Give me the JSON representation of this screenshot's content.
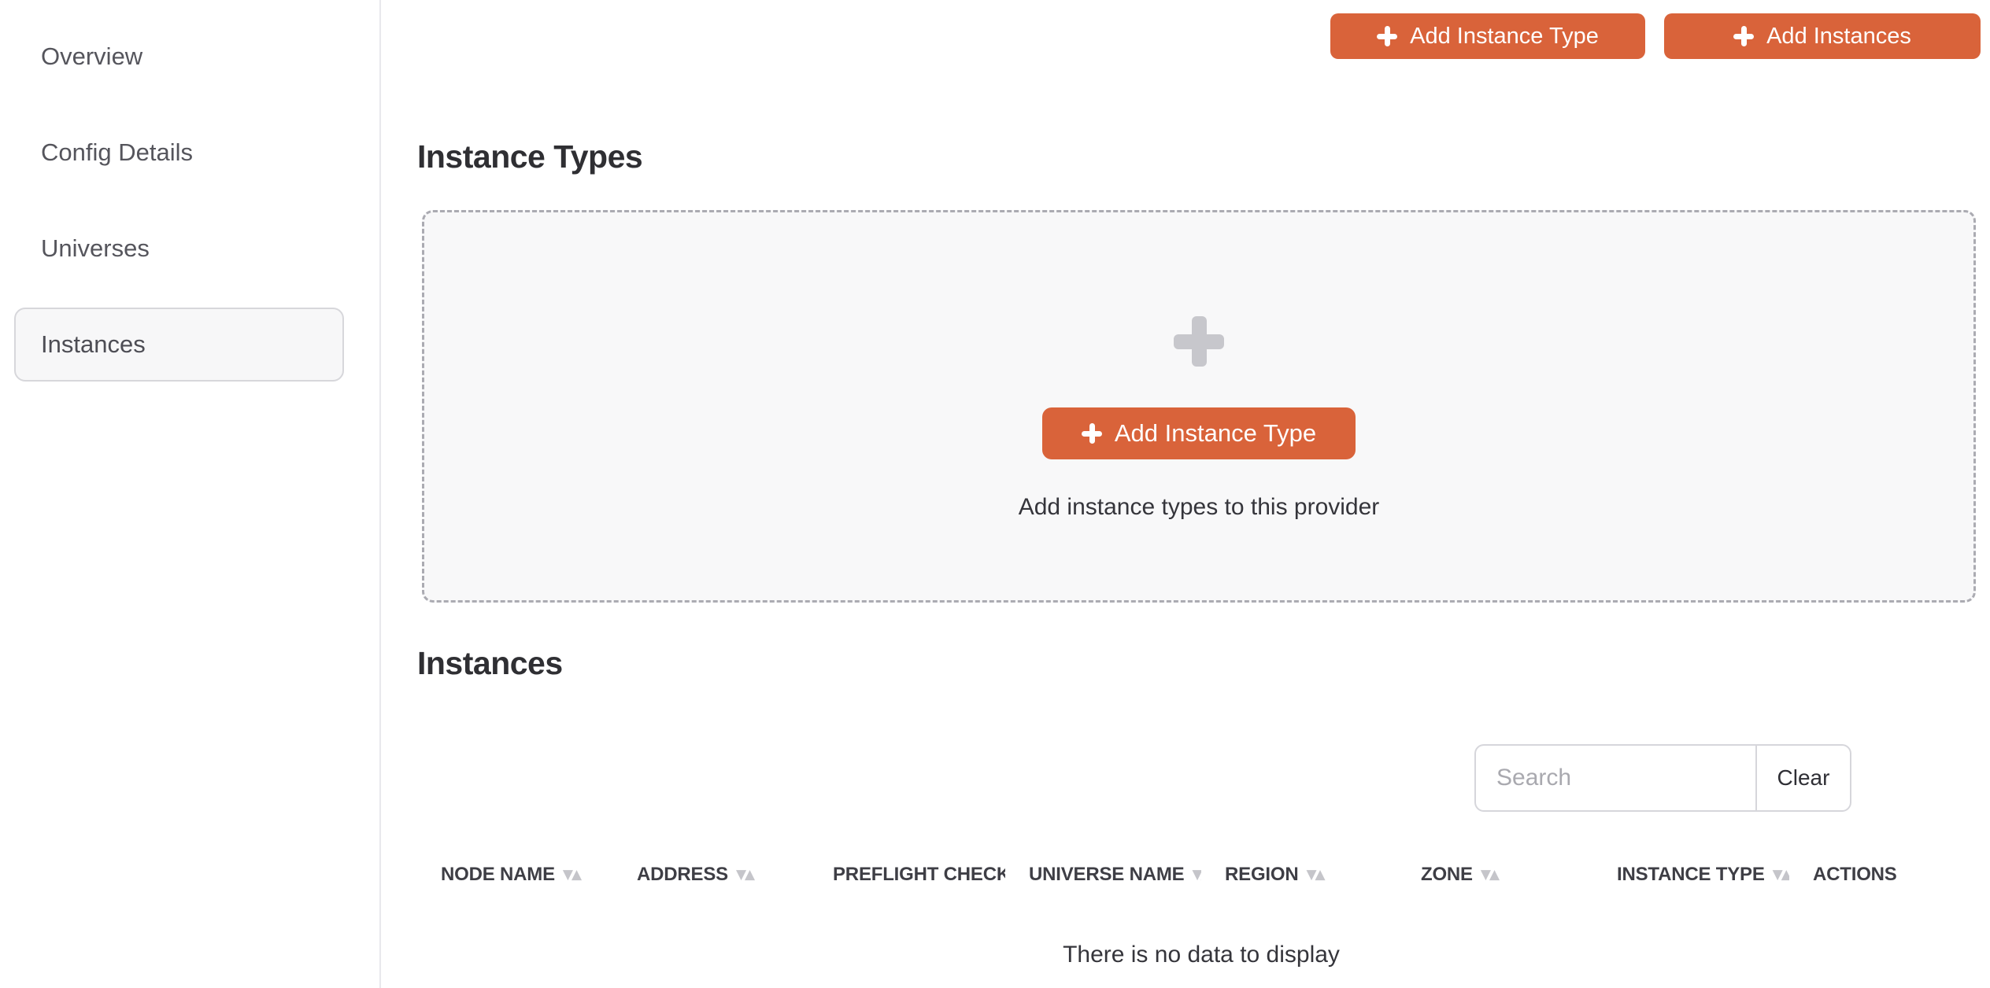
{
  "colors": {
    "accent_orange": "#d9633a",
    "sidebar_selected_bg": "#f7f7f8",
    "dashed_box_bg": "#f8f8f9",
    "dashed_border": "#ababb2",
    "muted_icon_gray": "#c7c7cc"
  },
  "sidebar": {
    "items": [
      {
        "label": "Overview",
        "selected": false
      },
      {
        "label": "Config Details",
        "selected": false
      },
      {
        "label": "Universes",
        "selected": false
      },
      {
        "label": "Instances",
        "selected": true
      }
    ]
  },
  "toolbar": {
    "add_instance_type_label": "Add Instance Type",
    "add_instances_label": "Add Instances"
  },
  "instance_types_section": {
    "title": "Instance Types",
    "empty_state": {
      "button_label": "Add Instance Type",
      "caption": "Add instance types to this provider"
    }
  },
  "instances_section": {
    "title": "Instances",
    "search": {
      "placeholder": "Search",
      "value": "",
      "clear_label": "Clear"
    },
    "table": {
      "columns": [
        {
          "label": "NODE NAME",
          "sortable": true
        },
        {
          "label": "ADDRESS",
          "sortable": true
        },
        {
          "label": "PREFLIGHT CHECK...",
          "sortable": false
        },
        {
          "label": "UNIVERSE NAME",
          "sortable": true
        },
        {
          "label": "REGION",
          "sortable": true
        },
        {
          "label": "ZONE",
          "sortable": true
        },
        {
          "label": "INSTANCE TYPE",
          "sortable": true
        },
        {
          "label": "ACTIONS",
          "sortable": false
        }
      ],
      "empty_message": "There is no data to display"
    }
  }
}
